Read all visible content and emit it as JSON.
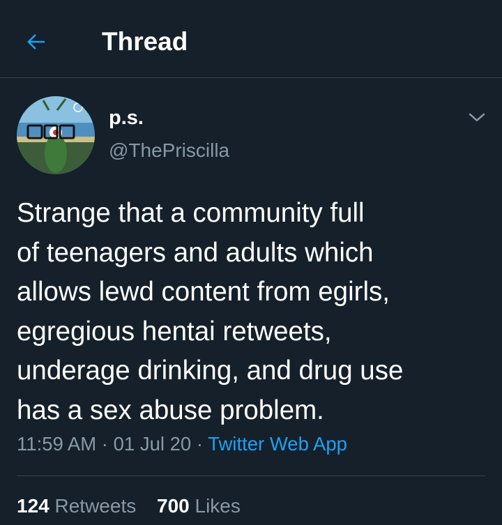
{
  "header": {
    "back_icon": "arrow-left-icon",
    "title": "Thread"
  },
  "tweet": {
    "author": {
      "display_name": "p.s.",
      "handle": "@ThePriscilla",
      "avatar": "avatar-character-with-glasses"
    },
    "more_icon": "chevron-down-icon",
    "text": "Strange that a community full\nof teenagers and adults which\nallows lewd content from egirls,\negregious hentai retweets,\nunderage drinking, and drug use\nhas a sex abuse problem.",
    "time": "11:59 AM",
    "date": "01 Jul 20",
    "separator": "·",
    "source": "Twitter Web App",
    "stats": {
      "retweets_count": "124",
      "retweets_label": "Retweets",
      "likes_count": "700",
      "likes_label": "Likes"
    }
  },
  "colors": {
    "background": "#15202b",
    "accent": "#1da1f2",
    "secondary_text": "#8899a6",
    "divider": "#38444d"
  }
}
